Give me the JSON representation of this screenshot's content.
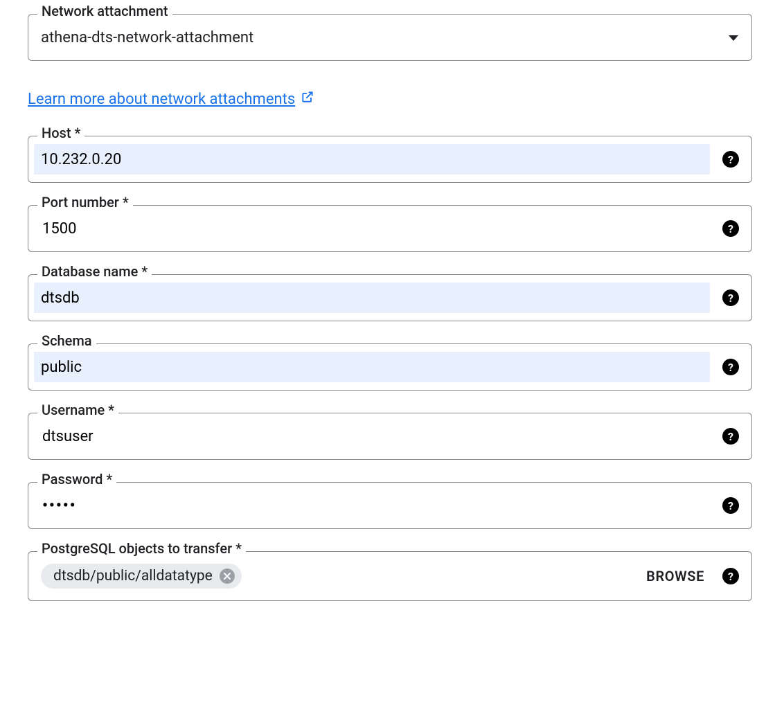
{
  "network_attachment": {
    "label": "Network attachment",
    "value": "athena-dts-network-attachment"
  },
  "learn_link": "Learn more about network attachments",
  "host": {
    "label": "Host *",
    "value": "10.232.0.20"
  },
  "port": {
    "label": "Port number *",
    "value": "1500"
  },
  "database": {
    "label": "Database name *",
    "value": "dtsdb"
  },
  "schema": {
    "label": "Schema",
    "value": "public"
  },
  "username": {
    "label": "Username *",
    "value": "dtsuser"
  },
  "password": {
    "label": "Password *",
    "value": "•••••"
  },
  "objects": {
    "label": "PostgreSQL objects to transfer *",
    "chip": "dtsdb/public/alldatatype",
    "browse": "BROWSE"
  }
}
